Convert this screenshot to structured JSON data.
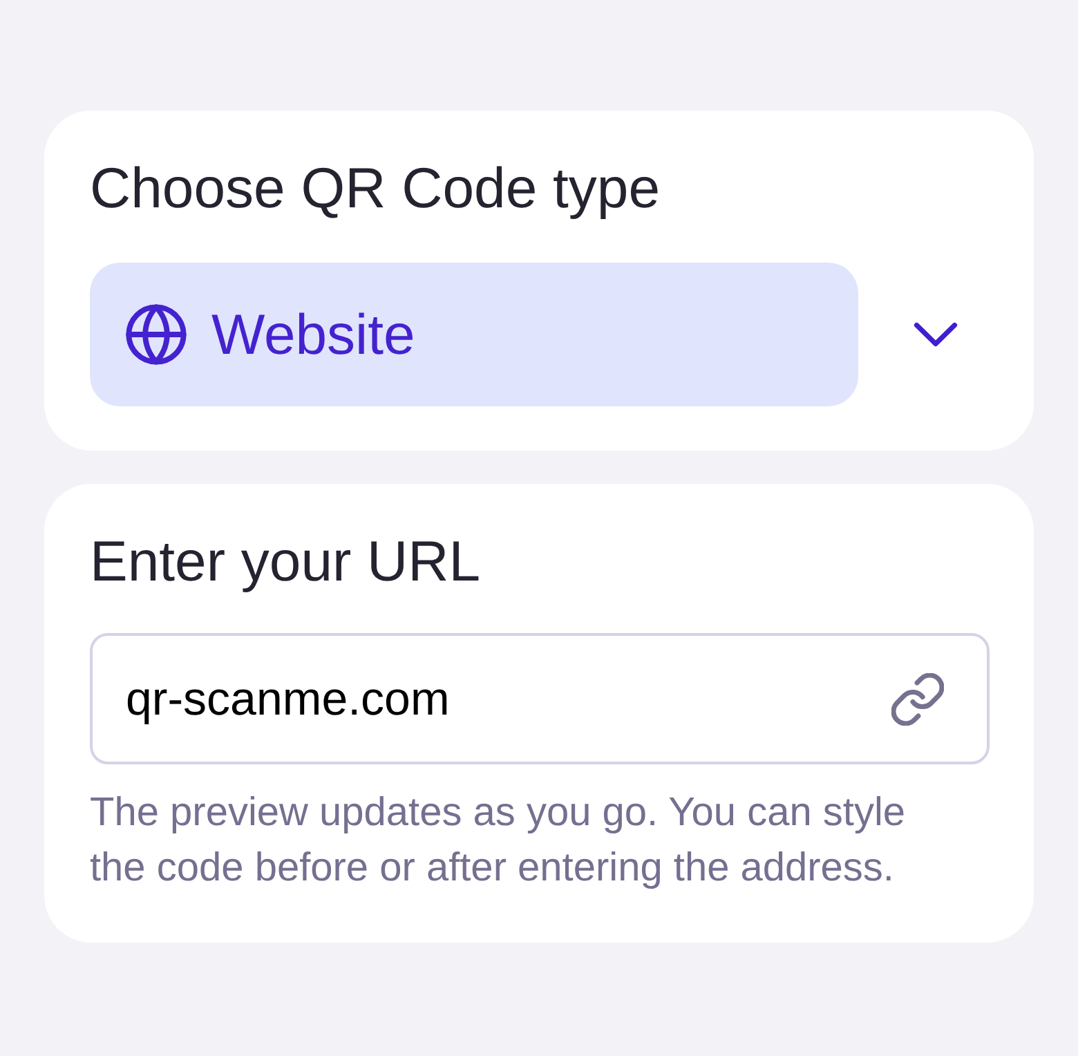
{
  "type_card": {
    "title": "Choose QR Code type",
    "selected_type": {
      "label": "Website"
    }
  },
  "url_card": {
    "title": "Enter your URL",
    "url_field": {
      "value": "qr-scanme.com"
    },
    "help_text": "The preview updates as you go. You can style the code before or after entering the address."
  }
}
